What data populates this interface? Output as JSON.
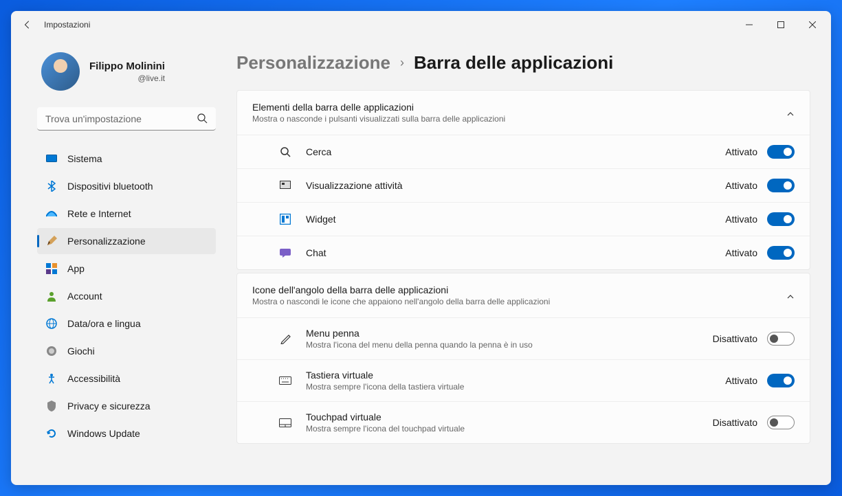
{
  "titlebar": {
    "title": "Impostazioni"
  },
  "user": {
    "name": "Filippo Molinini",
    "email": "@live.it"
  },
  "search": {
    "placeholder": "Trova un'impostazione"
  },
  "nav": {
    "items": [
      {
        "label": "Sistema"
      },
      {
        "label": "Dispositivi bluetooth"
      },
      {
        "label": "Rete e Internet"
      },
      {
        "label": "Personalizzazione"
      },
      {
        "label": "App"
      },
      {
        "label": "Account"
      },
      {
        "label": "Data/ora e lingua"
      },
      {
        "label": "Giochi"
      },
      {
        "label": "Accessibilità"
      },
      {
        "label": "Privacy e sicurezza"
      },
      {
        "label": "Windows Update"
      }
    ]
  },
  "breadcrumb": {
    "parent": "Personalizzazione",
    "current": "Barra delle applicazioni"
  },
  "sections": [
    {
      "title": "Elementi della barra delle applicazioni",
      "subtitle": "Mostra o nasconde i pulsanti visualizzati sulla barra delle applicazioni",
      "rows": [
        {
          "label": "Cerca",
          "state": "Attivato",
          "on": true
        },
        {
          "label": "Visualizzazione attività",
          "state": "Attivato",
          "on": true
        },
        {
          "label": "Widget",
          "state": "Attivato",
          "on": true
        },
        {
          "label": "Chat",
          "state": "Attivato",
          "on": true
        }
      ]
    },
    {
      "title": "Icone dell'angolo della barra delle applicazioni",
      "subtitle": "Mostra o nascondi le icone che appaiono nell'angolo della barra delle applicazioni",
      "rows": [
        {
          "label": "Menu penna",
          "desc": "Mostra l'icona del menu della penna quando la penna è in uso",
          "state": "Disattivato",
          "on": false
        },
        {
          "label": "Tastiera virtuale",
          "desc": "Mostra sempre l'icona della tastiera virtuale",
          "state": "Attivato",
          "on": true
        },
        {
          "label": "Touchpad virtuale",
          "desc": "Mostra sempre l'icona del touchpad virtuale",
          "state": "Disattivato",
          "on": false
        }
      ]
    }
  ]
}
